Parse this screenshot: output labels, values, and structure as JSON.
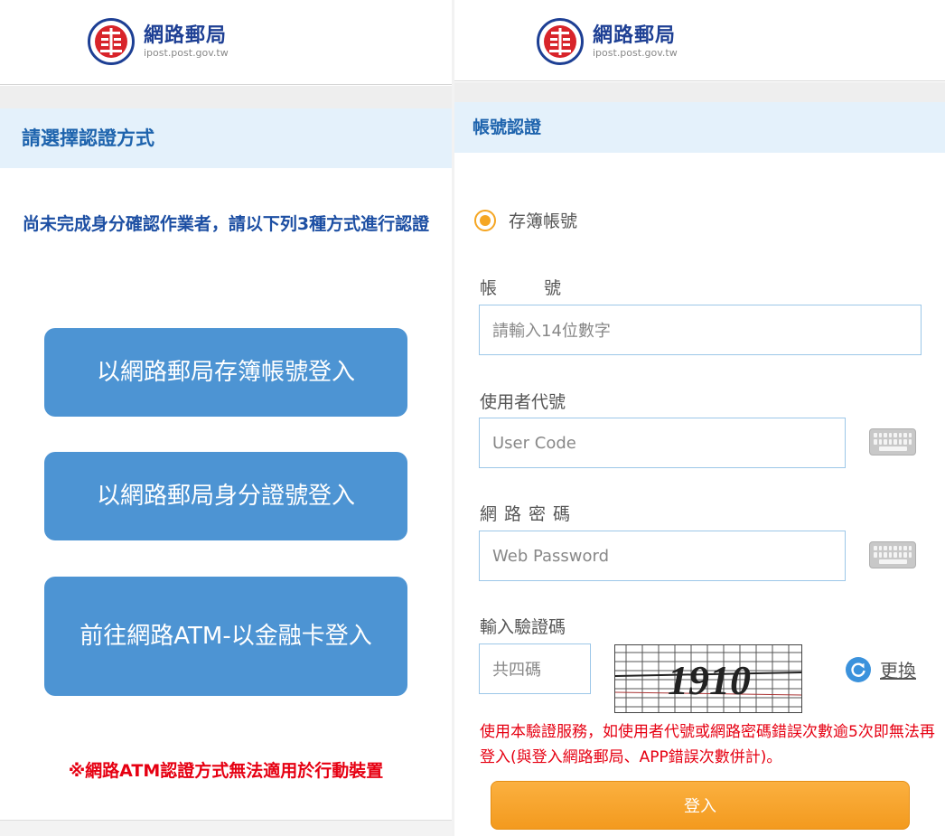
{
  "brand": {
    "title": "網路郵局",
    "domain": "ipost.post.gov.tw",
    "colors": {
      "brand_blue": "#1d3f94",
      "brand_red": "#d8242a"
    }
  },
  "left": {
    "section_title": "請選擇認證方式",
    "notice": "尚未完成身分確認作業者，請以下列3種方式進行認證",
    "buttons": {
      "passbook": "以網路郵局存簿帳號登入",
      "id": "以網路郵局身分證號登入",
      "atm": "前往網路ATM-以金融卡登入"
    },
    "warning": "※網路ATM認證方式無法適用於行動裝置",
    "colors": {
      "button": "#4d94d3",
      "warning": "#e60012"
    }
  },
  "right": {
    "section_title": "帳號認證",
    "radio_label": "存簿帳號",
    "account": {
      "label_a": "帳",
      "label_b": "號",
      "placeholder": "請輸入14位數字"
    },
    "user_code": {
      "label": "使用者代號",
      "placeholder": "User Code"
    },
    "password": {
      "label": "網路密碼",
      "placeholder": "Web Password"
    },
    "captcha": {
      "label": "輸入驗證碼",
      "placeholder": "共四碼",
      "image_text": "1910",
      "refresh_label": "更換"
    },
    "rule_text": "使用本驗證服務，如使用者代號或網路密碼錯誤次數逾5次即無法再登入(與登入網路郵局、APP錯誤次數併計)。",
    "login_label": "登入",
    "colors": {
      "radio": "#f5a623",
      "login": "#f39a1e"
    }
  },
  "icons": [
    "post-logo-icon",
    "keyboard-icon",
    "refresh-icon",
    "radio-selected-icon"
  ]
}
